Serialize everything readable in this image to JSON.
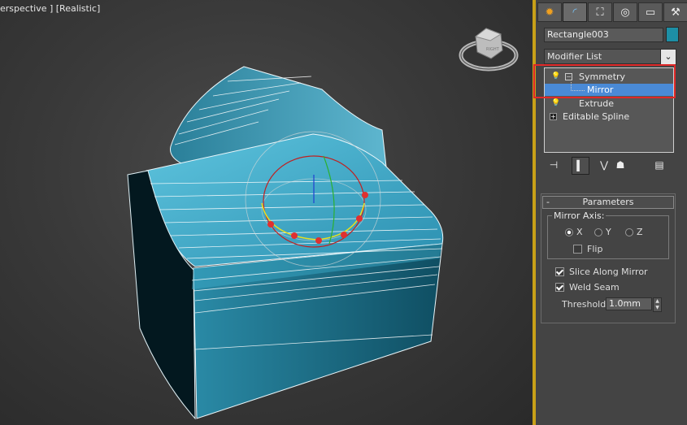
{
  "viewport": {
    "label": "erspective ] [Realistic]",
    "viewcube_face": "RIGHT"
  },
  "panel": {
    "tabs": [
      {
        "name": "create",
        "glyph": "✹"
      },
      {
        "name": "modify",
        "glyph": "◜"
      },
      {
        "name": "hierarchy",
        "glyph": "⛶"
      },
      {
        "name": "motion",
        "glyph": "◎"
      },
      {
        "name": "display",
        "glyph": "▭"
      },
      {
        "name": "utilities",
        "glyph": "⚒"
      }
    ],
    "object_name": "Rectangle003",
    "object_color": "#1d8fa6",
    "modifier_list_label": "Modifier List",
    "dropdown_glyph": "⌄",
    "stack": [
      {
        "label": "Symmetry",
        "selected": false
      },
      {
        "label": "Mirror",
        "selected": true
      },
      {
        "label": "Extrude",
        "selected": false
      },
      {
        "label": "Editable Spline",
        "selected": false
      }
    ],
    "stack_tool_glyphs": [
      "⊣",
      "▍",
      "⋁",
      "☗",
      "▤"
    ],
    "parameters": {
      "rollout_title": "Parameters",
      "collapse_glyph": "-",
      "mirror_axis_label": "Mirror Axis:",
      "axis_options": [
        "X",
        "Y",
        "Z"
      ],
      "selected_axis": "X",
      "flip_label": "Flip",
      "flip_checked": false,
      "slice_label": "Slice Along Mirror",
      "slice_checked": true,
      "weld_label": "Weld Seam",
      "weld_checked": true,
      "threshold_label": "Threshold:",
      "threshold_value": "1.0mm"
    }
  },
  "colors": {
    "selection_highlight": "#4a8ad6",
    "annotation_box": "#e02828",
    "active_border": "#c8a018",
    "object_teal": "#2a8da8"
  }
}
